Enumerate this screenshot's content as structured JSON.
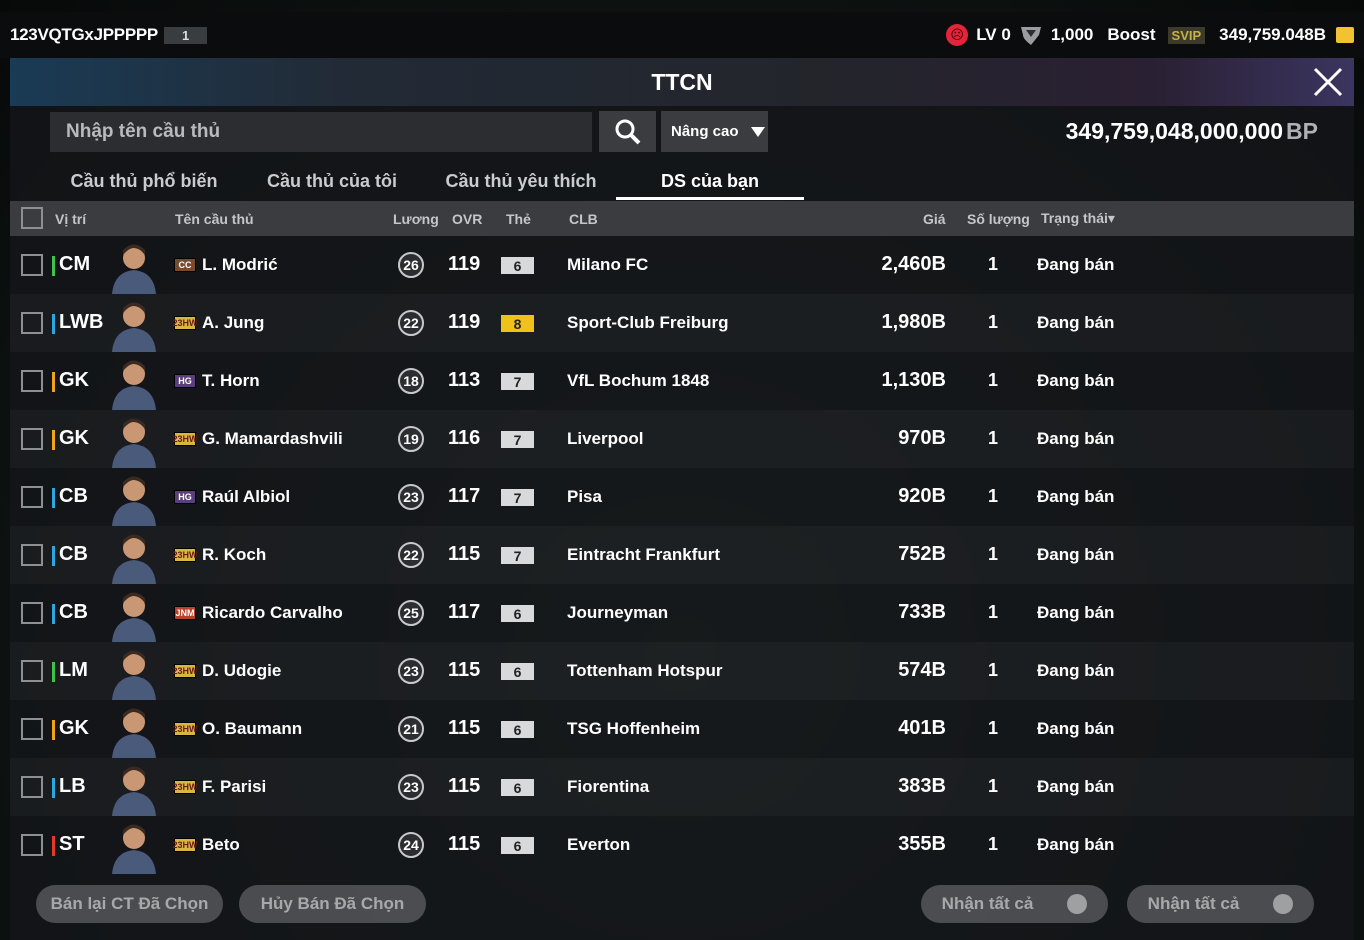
{
  "topbar": {
    "username": "123VQTGxJPPPPP",
    "level_badge": "1",
    "lv_label": "LV 0",
    "trophy_value": "1,000",
    "boost_label": "Boost",
    "svip_label": "SVIP",
    "bp_balance": "349,759.048B"
  },
  "header": {
    "title": "TTCN"
  },
  "search": {
    "placeholder": "Nhập tên cầu thủ",
    "advanced_label": "Nâng cao"
  },
  "bp_total": {
    "value": "349,759,048,000,000",
    "unit": "BP"
  },
  "tabs": [
    {
      "label": "Cầu thủ phổ biến"
    },
    {
      "label": "Cầu thủ của tôi"
    },
    {
      "label": "Cầu thủ yêu thích"
    },
    {
      "label": "DS của bạn",
      "active": true
    }
  ],
  "columns": {
    "position": "Vị trí",
    "name": "Tên cầu thủ",
    "salary": "Lương",
    "ovr": "OVR",
    "grade": "Thẻ",
    "club": "CLB",
    "price": "Giá",
    "quantity": "Số lượng",
    "status": "Trạng thái▾"
  },
  "rows": [
    {
      "pos": "CM",
      "pos_color": "#3fc24a",
      "season": "CC",
      "season_color": "#7b4a2a",
      "name": "L. Modrić",
      "salary": "26",
      "ovr": "119",
      "grade": "6",
      "grade_gold": false,
      "club": "Milano FC",
      "price": "2,460B",
      "qty": "1",
      "status": "Đang bán"
    },
    {
      "pos": "LWB",
      "pos_color": "#2ea7e0",
      "season": "23HW",
      "season_color": "#d8b640",
      "name": "A. Jung",
      "salary": "22",
      "ovr": "119",
      "grade": "8",
      "grade_gold": true,
      "club": "Sport-Club Freiburg",
      "price": "1,980B",
      "qty": "1",
      "status": "Đang bán"
    },
    {
      "pos": "GK",
      "pos_color": "#f0a41c",
      "season": "HG",
      "season_color": "#5b3f7d",
      "name": "T. Horn",
      "salary": "18",
      "ovr": "113",
      "grade": "7",
      "grade_gold": false,
      "club": "VfL Bochum 1848",
      "price": "1,130B",
      "qty": "1",
      "status": "Đang bán"
    },
    {
      "pos": "GK",
      "pos_color": "#f0a41c",
      "season": "23HW",
      "season_color": "#d8b640",
      "name": "G. Mamardashvili",
      "salary": "19",
      "ovr": "116",
      "grade": "7",
      "grade_gold": false,
      "club": "Liverpool",
      "price": "970B",
      "qty": "1",
      "status": "Đang bán"
    },
    {
      "pos": "CB",
      "pos_color": "#2ea7e0",
      "season": "HG",
      "season_color": "#5b3f7d",
      "name": "Raúl Albiol",
      "salary": "23",
      "ovr": "117",
      "grade": "7",
      "grade_gold": false,
      "club": "Pisa",
      "price": "920B",
      "qty": "1",
      "status": "Đang bán"
    },
    {
      "pos": "CB",
      "pos_color": "#2ea7e0",
      "season": "23HW",
      "season_color": "#d8b640",
      "name": "R. Koch",
      "salary": "22",
      "ovr": "115",
      "grade": "7",
      "grade_gold": false,
      "club": "Eintracht Frankfurt",
      "price": "752B",
      "qty": "1",
      "status": "Đang bán"
    },
    {
      "pos": "CB",
      "pos_color": "#2ea7e0",
      "season": "JNM",
      "season_color": "#b8402c",
      "name": "Ricardo Carvalho",
      "salary": "25",
      "ovr": "117",
      "grade": "6",
      "grade_gold": false,
      "club": "Journeyman",
      "price": "733B",
      "qty": "1",
      "status": "Đang bán"
    },
    {
      "pos": "LM",
      "pos_color": "#3fc24a",
      "season": "23HW",
      "season_color": "#d8b640",
      "name": "D. Udogie",
      "salary": "23",
      "ovr": "115",
      "grade": "6",
      "grade_gold": false,
      "club": "Tottenham Hotspur",
      "price": "574B",
      "qty": "1",
      "status": "Đang bán"
    },
    {
      "pos": "GK",
      "pos_color": "#f0a41c",
      "season": "23HW",
      "season_color": "#d8b640",
      "name": "O. Baumann",
      "salary": "21",
      "ovr": "115",
      "grade": "6",
      "grade_gold": false,
      "club": "TSG Hoffenheim",
      "price": "401B",
      "qty": "1",
      "status": "Đang bán"
    },
    {
      "pos": "LB",
      "pos_color": "#2ea7e0",
      "season": "23HW",
      "season_color": "#d8b640",
      "name": "F. Parisi",
      "salary": "23",
      "ovr": "115",
      "grade": "6",
      "grade_gold": false,
      "club": "Fiorentina",
      "price": "383B",
      "qty": "1",
      "status": "Đang bán"
    },
    {
      "pos": "ST",
      "pos_color": "#e23b2e",
      "season": "23HW",
      "season_color": "#d8b640",
      "name": "Beto",
      "salary": "24",
      "ovr": "115",
      "grade": "6",
      "grade_gold": false,
      "club": "Everton",
      "price": "355B",
      "qty": "1",
      "status": "Đang bán"
    }
  ],
  "footer": {
    "resell_selected": "Bán lại CT Đã Chọn",
    "cancel_selected": "Hủy Bán Đã Chọn",
    "claim_all_1": "Nhận tất cả",
    "claim_all_2": "Nhận tất cả"
  },
  "colors": {
    "accent": "#efc11a",
    "panel": "#141619",
    "header_bar": "#3a3c3f"
  }
}
